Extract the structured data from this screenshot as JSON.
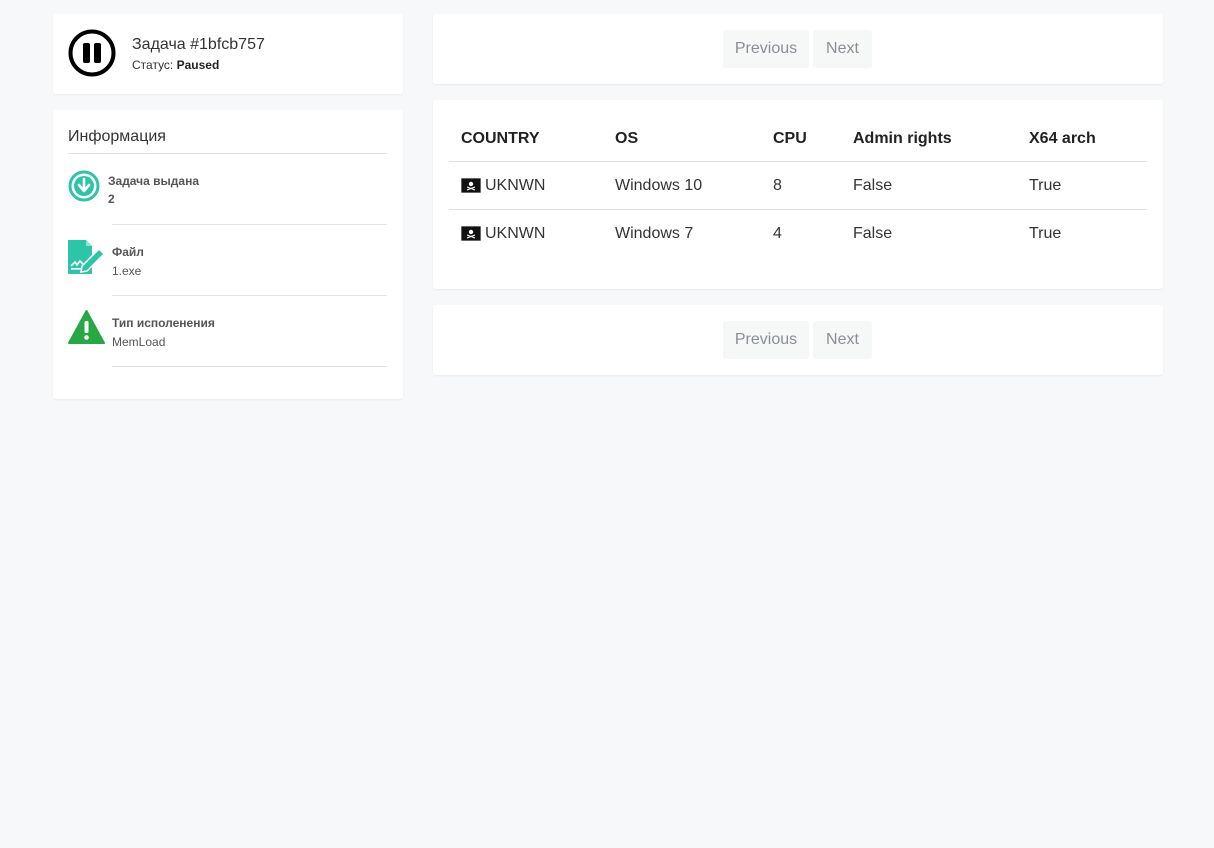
{
  "task": {
    "title": "Задача #1bfcb757",
    "status_label": "Статус:",
    "status_value": "Paused",
    "status_icon": "pause-circle-icon"
  },
  "info": {
    "heading": "Информация",
    "items": [
      {
        "label": "Задача выдана",
        "value": "2",
        "icon": "download-circle-icon",
        "color": "#2ec4a8"
      },
      {
        "label": "Файл",
        "value": "1.exe",
        "icon": "file-signature-icon",
        "color": "#2ec4a8"
      },
      {
        "label": "Тип исполенения",
        "value": "MemLoad",
        "icon": "warning-triangle-icon",
        "color": "#28a745"
      }
    ]
  },
  "pagination": {
    "previous_label": "Previous",
    "next_label": "Next"
  },
  "table": {
    "columns": [
      "COUNTRY",
      "OS",
      "CPU",
      "Admin rights",
      "X64 arch"
    ],
    "rows": [
      {
        "country": "UKNWN",
        "flag_icon": "pirate-flag-icon",
        "os": "Windows 10",
        "cpu": "8",
        "admin": "False",
        "x64": "True"
      },
      {
        "country": "UKNWN",
        "flag_icon": "pirate-flag-icon",
        "os": "Windows 7",
        "cpu": "4",
        "admin": "False",
        "x64": "True"
      }
    ]
  }
}
